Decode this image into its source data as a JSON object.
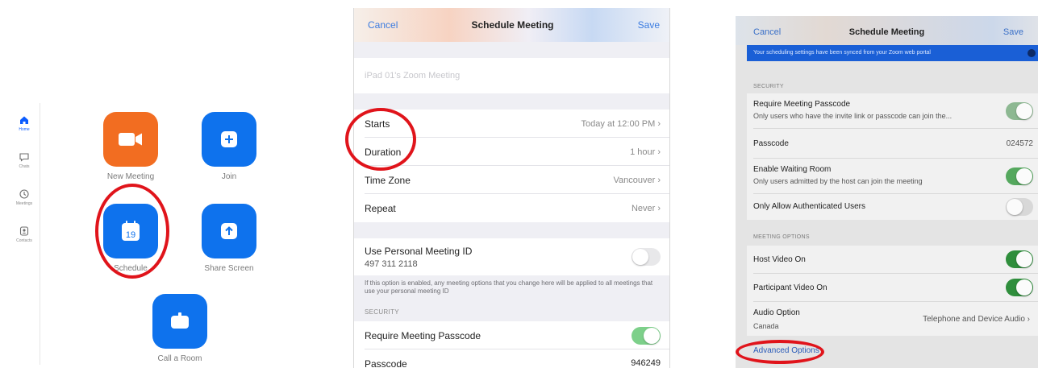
{
  "home": {
    "sidebar": [
      {
        "label": "Home",
        "icon": "home-icon"
      },
      {
        "label": "Chats",
        "icon": "chat-icon"
      },
      {
        "label": "Meetings",
        "icon": "clock-icon"
      },
      {
        "label": "Contacts",
        "icon": "contacts-icon"
      }
    ],
    "tiles": {
      "new_meeting": "New Meeting",
      "join": "Join",
      "schedule": "Schedule",
      "schedule_date": "19",
      "share_screen": "Share Screen",
      "call_room": "Call a Room"
    },
    "colors": {
      "orange": "#f26d21",
      "blue": "#0e72ed",
      "highlight": "#e0141b"
    }
  },
  "schedule_a": {
    "nav": {
      "cancel": "Cancel",
      "title": "Schedule Meeting",
      "save": "Save"
    },
    "topic_placeholder": "iPad 01's Zoom Meeting",
    "rows": {
      "starts_label": "Starts",
      "starts_value": "Today at 12:00 PM",
      "duration_label": "Duration",
      "duration_value": "1 hour",
      "timezone_label": "Time Zone",
      "timezone_value": "Vancouver",
      "repeat_label": "Repeat",
      "repeat_value": "Never"
    },
    "pmi": {
      "label": "Use Personal Meeting ID",
      "id": "497 311 2118",
      "note": "If this option is enabled, any meeting options that you change here will be applied to all meetings that use your personal meeting ID"
    },
    "security_header": "SECURITY",
    "passcode_req_label": "Require Meeting Passcode",
    "passcode_label": "Passcode",
    "passcode_value": "946249"
  },
  "schedule_b": {
    "nav": {
      "cancel": "Cancel",
      "title": "Schedule Meeting",
      "save": "Save"
    },
    "banner": "Your scheduling settings have been synced from your Zoom web portal",
    "security_header": "SECURITY",
    "require_passcode": {
      "label": "Require Meeting Passcode",
      "sub": "Only users who have the invite link or passcode can join the..."
    },
    "passcode": {
      "label": "Passcode",
      "value": "024572"
    },
    "waiting_room": {
      "label": "Enable Waiting Room",
      "sub": "Only users admitted by the host can join the meeting"
    },
    "auth_users": {
      "label": "Only Allow Authenticated Users"
    },
    "meeting_options_header": "MEETING OPTIONS",
    "host_video": {
      "label": "Host Video On"
    },
    "participant_video": {
      "label": "Participant Video On"
    },
    "audio": {
      "label": "Audio Option",
      "sub": "Canada",
      "value": "Telephone and Device Audio"
    },
    "advanced": "Advanced Options"
  }
}
